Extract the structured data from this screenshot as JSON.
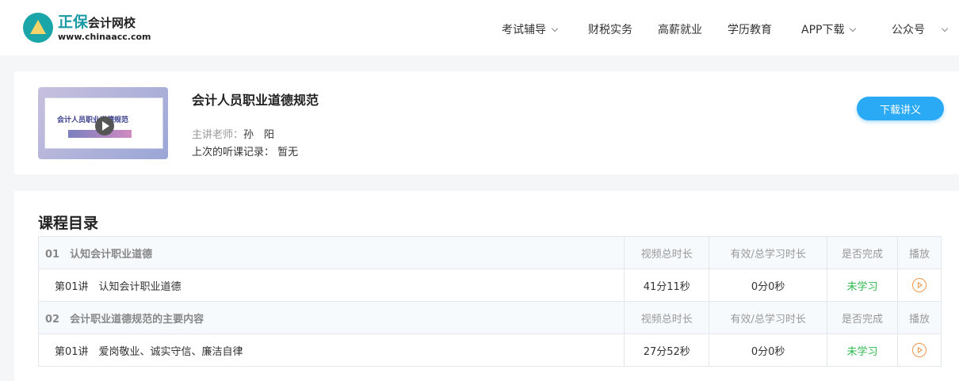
{
  "logo": {
    "brand": "正保",
    "name": "会计网校",
    "url": "www.chinaacc.com"
  },
  "nav": [
    {
      "label": "考试辅导",
      "dropdown": true
    },
    {
      "label": "财税实务"
    },
    {
      "label": "高薪就业"
    },
    {
      "label": "学历教育"
    },
    {
      "label": "APP下载",
      "dropdown": true
    },
    {
      "label": "公众号",
      "dropdown": true
    }
  ],
  "course": {
    "thumb_title": "会计人员职业道德规范",
    "title": "会计人员职业道德规范",
    "teacher_label": "主讲老师：",
    "teacher": "孙　阳",
    "record_label": "上次的听课记录：",
    "record": "暂无",
    "download": "下载讲义"
  },
  "catalog": {
    "title": "课程目录",
    "headers": [
      "视频总时长",
      "有效/总学习时长",
      "是否完成",
      "播放"
    ],
    "chapters": [
      {
        "title": "01　认知会计职业道德",
        "lessons": [
          {
            "title": "第01讲　认知会计职业道德",
            "duration": "41分11秒",
            "studied": "0分0秒",
            "status": "未学习"
          }
        ]
      },
      {
        "title": "02　会计职业道德规范的主要内容",
        "lessons": [
          {
            "title": "第01讲　爱岗敬业、诚实守信、廉洁自律",
            "duration": "27分52秒",
            "studied": "0分0秒",
            "status": "未学习"
          }
        ]
      }
    ]
  },
  "colors": {
    "accent": "#2aa9f4",
    "status": "#2fb84f",
    "play": "#f0954c"
  }
}
